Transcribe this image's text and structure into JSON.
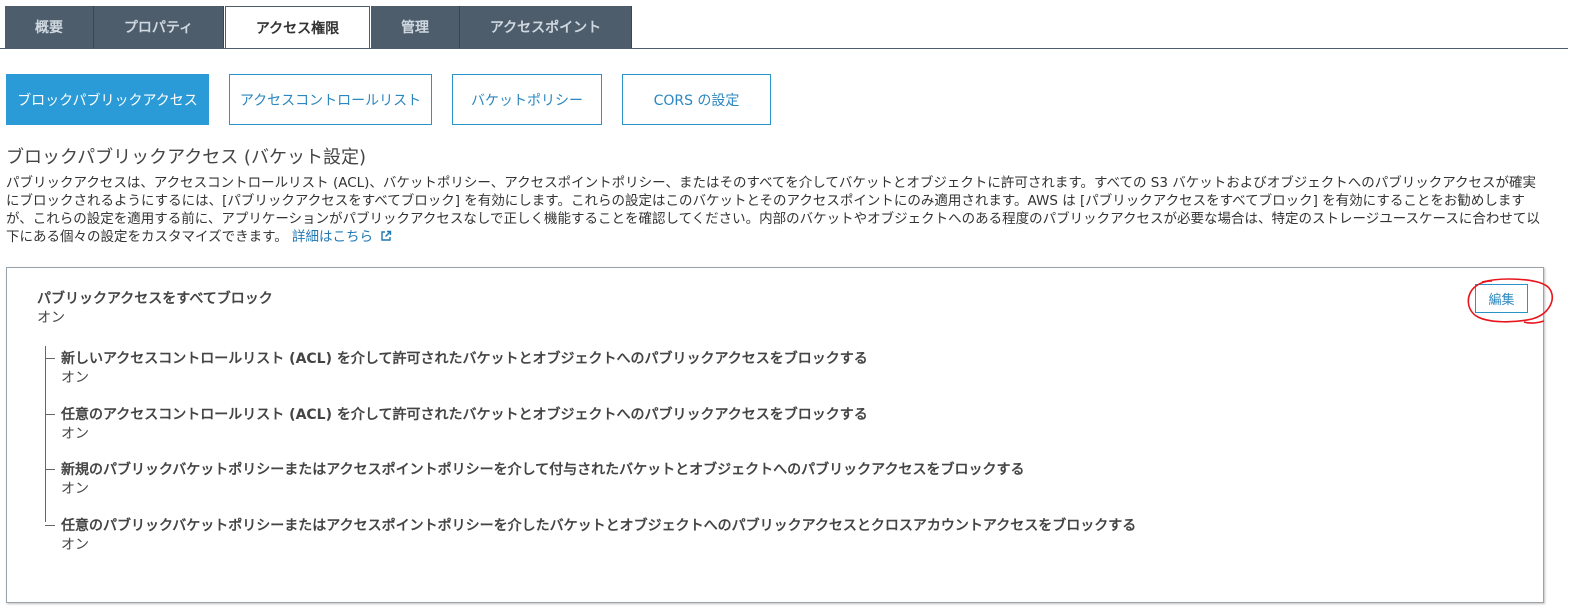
{
  "tabs": [
    {
      "label": "概要",
      "active": false
    },
    {
      "label": "プロパティ",
      "active": false
    },
    {
      "label": "アクセス権限",
      "active": true
    },
    {
      "label": "管理",
      "active": false
    },
    {
      "label": "アクセスポイント",
      "active": false
    }
  ],
  "subtabs": [
    {
      "label": "ブロックパブリックアクセス",
      "active": true
    },
    {
      "label": "アクセスコントロールリスト",
      "active": false
    },
    {
      "label": "バケットポリシー",
      "active": false
    },
    {
      "label": "CORS の設定",
      "active": false
    }
  ],
  "section": {
    "title": "ブロックパブリックアクセス (バケット設定)",
    "description": "パブリックアクセスは、アクセスコントロールリスト (ACL)、バケットポリシー、アクセスポイントポリシー、またはそのすべてを介してバケットとオブジェクトに許可されます。すべての S3 バケットおよびオブジェクトへのパブリックアクセスが確実にブロックされるようにするには、[パブリックアクセスをすべてブロック] を有効にします。これらの設定はこのバケットとそのアクセスポイントにのみ適用されます。AWS は [パブリックアクセスをすべてブロック] を有効にすることをお勧めしますが、これらの設定を適用する前に、アプリケーションがパブリックアクセスなしで正しく機能することを確認してください。内部のバケットやオブジェクトへのある程度のパブリックアクセスが必要な場合は、特定のストレージユースケースに合わせて以下にある個々の設定をカスタマイズできます。",
    "learn_more": "詳細はこちら",
    "external_icon": "external-link-icon"
  },
  "panel": {
    "main_label": "パブリックアクセスをすべてブロック",
    "main_value": "オン",
    "edit_label": "編集",
    "annotation_color": "#e8141b",
    "items": [
      {
        "label": "新しいアクセスコントロールリスト (ACL) を介して許可されたバケットとオブジェクトへのパブリックアクセスをブロックする",
        "value": "オン"
      },
      {
        "label": "任意のアクセスコントロールリスト (ACL) を介して許可されたバケットとオブジェクトへのパブリックアクセスをブロックする",
        "value": "オン"
      },
      {
        "label": "新規のパブリックバケットポリシーまたはアクセスポイントポリシーを介して付与されたバケットとオブジェクトへのパブリックアクセスをブロックする",
        "value": "オン"
      },
      {
        "label": "任意のパブリックバケットポリシーまたはアクセスポイントポリシーを介したバケットとオブジェクトへのパブリックアクセスとクロスアカウントアクセスをブロックする",
        "value": "オン"
      }
    ]
  },
  "colors": {
    "tab_bg": "#4d5d6b",
    "accent": "#2b9bd8",
    "link": "#1f78b4"
  }
}
